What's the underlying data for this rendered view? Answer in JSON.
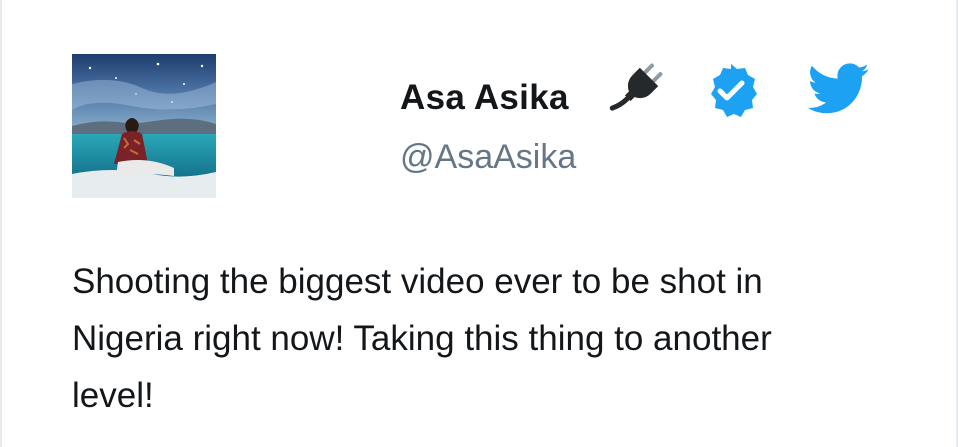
{
  "tweet": {
    "author": {
      "display_name": "Asa  Asika",
      "handle": "@AsaAsika",
      "avatar": "profile-photo-seated-by-sea"
    },
    "name_emoji": "electric-plug-icon",
    "verified_badge": "verified-badge-icon",
    "platform_icon": "twitter-bird-icon",
    "text": "Shooting the biggest video ever to be shot in Nigeria right now! Taking this thing to another level!"
  },
  "colors": {
    "verified_blue": "#1da1f2",
    "twitter_blue": "#1da1f2",
    "text_primary": "#14171a",
    "text_secondary": "#657786"
  }
}
